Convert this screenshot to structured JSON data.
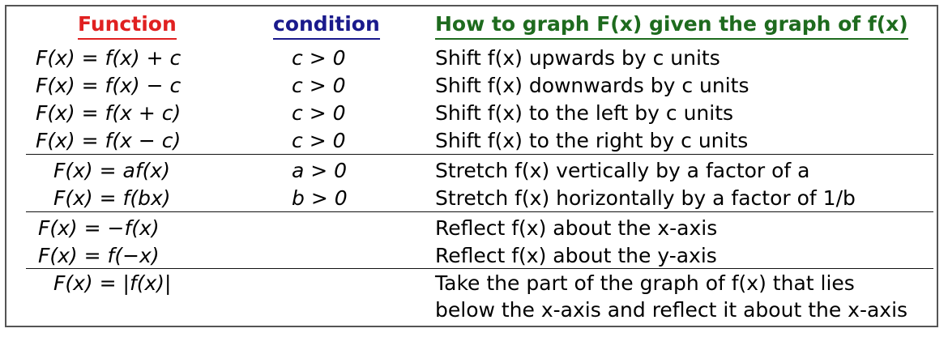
{
  "headers": {
    "function": "Function",
    "condition": "condition",
    "how": "How to graph F(x) given the graph of f(x)"
  },
  "rows": [
    {
      "function": "F(x) = f(x) + c",
      "condition": "c > 0",
      "description": "Shift f(x) upwards by c units"
    },
    {
      "function": "F(x) = f(x) − c",
      "condition": "c > 0",
      "description": "Shift f(x) downwards by c units"
    },
    {
      "function": "F(x) = f(x + c)",
      "condition": "c > 0",
      "description": "Shift f(x) to the left by c units"
    },
    {
      "function": "F(x) = f(x − c)",
      "condition": "c > 0",
      "description": "Shift f(x) to the right by c units"
    },
    {
      "function": "F(x) = af(x)",
      "condition": "a > 0",
      "description": "Stretch f(x) vertically by a factor of a"
    },
    {
      "function": "F(x) = f(bx)",
      "condition": "b > 0",
      "description": "Stretch f(x) horizontally by a factor of 1/b"
    },
    {
      "function": "F(x) = −f(x)",
      "condition": "",
      "description": "Reflect f(x) about the x-axis"
    },
    {
      "function": "F(x) = f(−x)",
      "condition": "",
      "description": "Reflect f(x) about the y-axis"
    },
    {
      "function": "F(x) = |f(x)|",
      "condition": "",
      "description": "Take the part of the graph of f(x) that lies"
    },
    {
      "function": "",
      "condition": "",
      "description": "below the x-axis and reflect it about the x-axis"
    }
  ],
  "colors": {
    "function_header": "#e02020",
    "condition_header": "#1a1a8c",
    "how_header": "#1e6b1e",
    "frame": "#555555"
  }
}
